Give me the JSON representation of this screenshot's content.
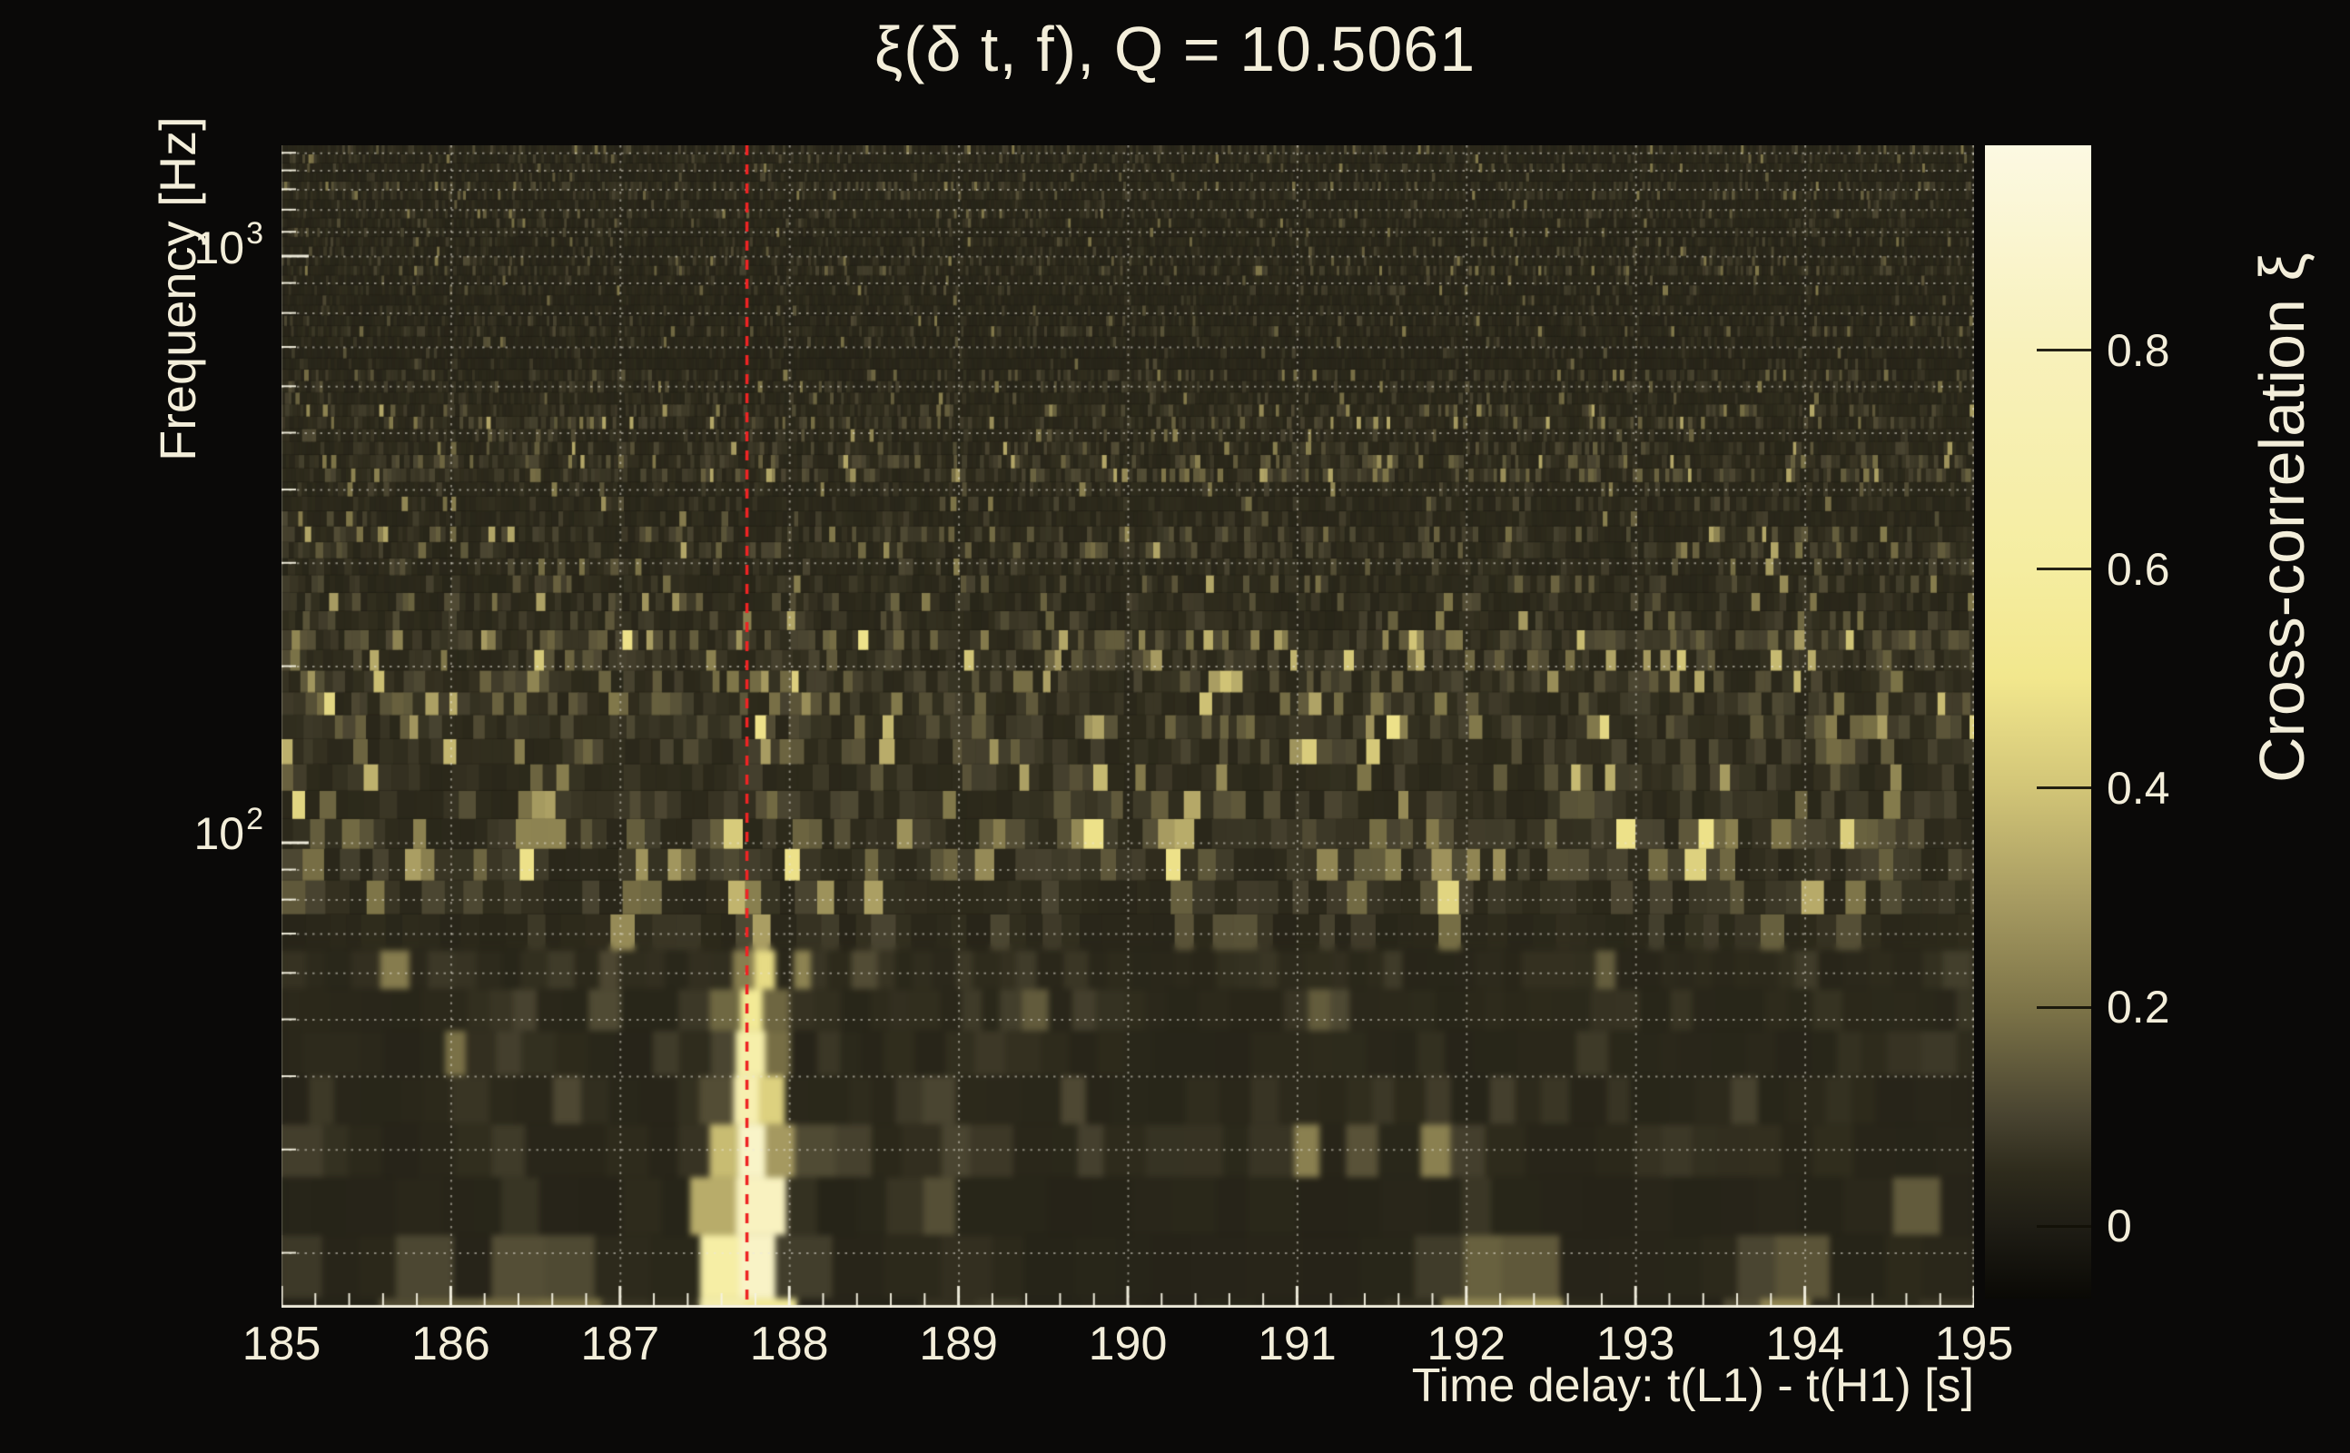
{
  "page": {
    "background": "#0a0908",
    "text_color": "#f3eeda"
  },
  "chart_data": {
    "type": "heatmap",
    "title": "ξ(δ t, f), Q = 10.5061",
    "xlabel": "Time delay: t(L1) - t(H1) [s]",
    "ylabel": "Frequency [Hz]",
    "x_range": [
      185,
      195
    ],
    "x_tick_labels": [
      "185",
      "186",
      "187",
      "188",
      "189",
      "190",
      "191",
      "192",
      "193",
      "194",
      "195"
    ],
    "x_minor_tick_step": 0.2,
    "y_scale": "log",
    "y_range_hz": [
      16.1,
      1548
    ],
    "y_major_ticks": [
      {
        "base": "10",
        "exp": "3",
        "value_hz": 1000
      },
      {
        "base": "10",
        "exp": "2",
        "value_hz": 100
      }
    ],
    "y_minor_gridlines_hz": [
      20,
      30,
      40,
      50,
      60,
      70,
      80,
      90,
      200,
      300,
      400,
      500,
      600,
      700,
      800,
      900,
      1100,
      1200,
      1300,
      1400,
      1500
    ],
    "y_major_gridlines_hz": [
      100,
      1000
    ],
    "grid": {
      "style": "dotted",
      "color": "rgba(235,232,220,0.5)"
    },
    "event_marker": {
      "type": "vertical-dashed-line",
      "x": 187.75,
      "color": "#ee2424"
    },
    "peak": {
      "time_delay_s": 187.75,
      "freq_hz_range": [
        16,
        60
      ],
      "xi_max": 0.97
    },
    "colorbar": {
      "label": "Cross-correlation ξ",
      "tick_values": [
        0,
        0.2,
        0.4,
        0.6,
        0.8
      ],
      "tick_labels": [
        "0",
        "0.2",
        "0.4",
        "0.6",
        "0.8"
      ],
      "range": [
        -0.066,
        0.987
      ],
      "gradient_stops": [
        {
          "v": -0.066,
          "c": "#0a0905"
        },
        {
          "v": 0.0,
          "c": "#1f1d15"
        },
        {
          "v": 0.05,
          "c": "#2e2b1c"
        },
        {
          "v": 0.1,
          "c": "#484330"
        },
        {
          "v": 0.2,
          "c": "#7d7448"
        },
        {
          "v": 0.3,
          "c": "#a89c62"
        },
        {
          "v": 0.4,
          "c": "#d2c577"
        },
        {
          "v": 0.5,
          "c": "#f2e78d"
        },
        {
          "v": 0.6,
          "c": "#f5eda0"
        },
        {
          "v": 0.8,
          "c": "#f8f1bb"
        },
        {
          "v": 0.987,
          "c": "#fcf9e2"
        }
      ]
    },
    "noise": {
      "seed": 20150914,
      "bands": [
        {
          "y_max": 430,
          "base": 0.025,
          "amp": 0.045,
          "pb": 0.03,
          "bmax": 0.18
        },
        {
          "y_max": 700,
          "base": 0.03,
          "amp": 0.06,
          "pb": 0.06,
          "bmax": 0.28
        },
        {
          "y_max": 1010,
          "base": 0.035,
          "amp": 0.11,
          "pb": 0.13,
          "bmax": 0.42
        },
        {
          "y_max": 1140,
          "base": 0.03,
          "amp": 0.085,
          "pb": 0.08,
          "bmax": 0.33
        },
        {
          "y_max": 1310,
          "base": 0.025,
          "amp": 0.05,
          "pb": 0.04,
          "bmax": 0.2
        },
        {
          "y_max": 1441,
          "base": 0.022,
          "amp": 0.035,
          "pb": 0.03,
          "bmax": 0.15
        }
      ],
      "blob": {
        "y_start": 975,
        "y_end": 1440,
        "x_at_start": 838,
        "x_at_end": 818,
        "sigma_start": 7,
        "sigma_end": 32,
        "a_mid": 0.55,
        "a_max": 0.97
      },
      "bottom_smears": [
        {
          "x": 470,
          "a": 0.22,
          "s": 28
        },
        {
          "x": 600,
          "a": 0.28,
          "s": 38
        },
        {
          "x": 1080,
          "a": 0.12,
          "s": 30
        },
        {
          "x": 1640,
          "a": 0.3,
          "s": 45
        },
        {
          "x": 1700,
          "a": 0.32,
          "s": 22
        },
        {
          "x": 1965,
          "a": 0.26,
          "s": 35
        },
        {
          "x": 2120,
          "a": 0.15,
          "s": 22
        }
      ]
    }
  }
}
